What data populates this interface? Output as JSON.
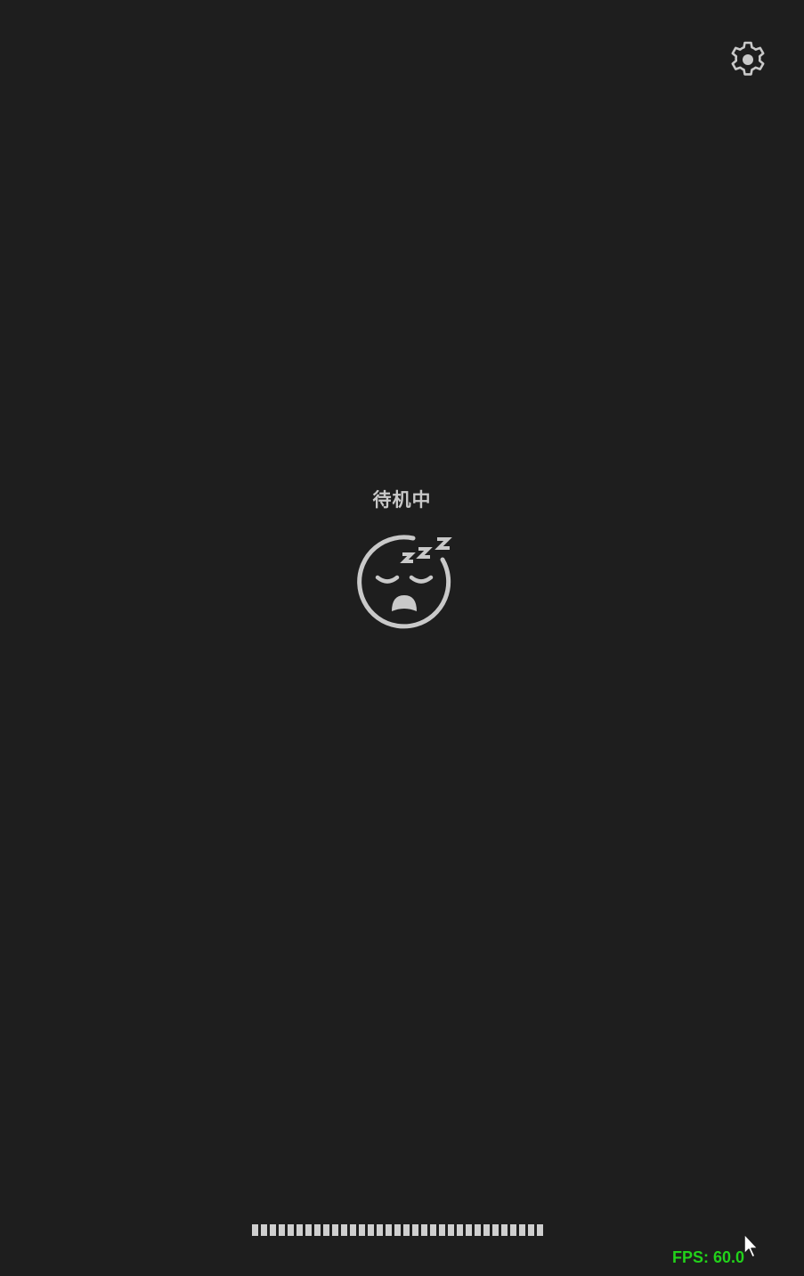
{
  "header": {
    "settings_icon": "gear-icon"
  },
  "status": {
    "label": "待机中",
    "icon": "sleeping-face-icon",
    "color": "#c9c9c9"
  },
  "progress": {
    "segments": 33,
    "color": "#cfcfcf"
  },
  "footer": {
    "fps_text": "FPS: 60.0",
    "fps_color": "#22d11a"
  },
  "theme": {
    "background": "#1e1e1e"
  }
}
